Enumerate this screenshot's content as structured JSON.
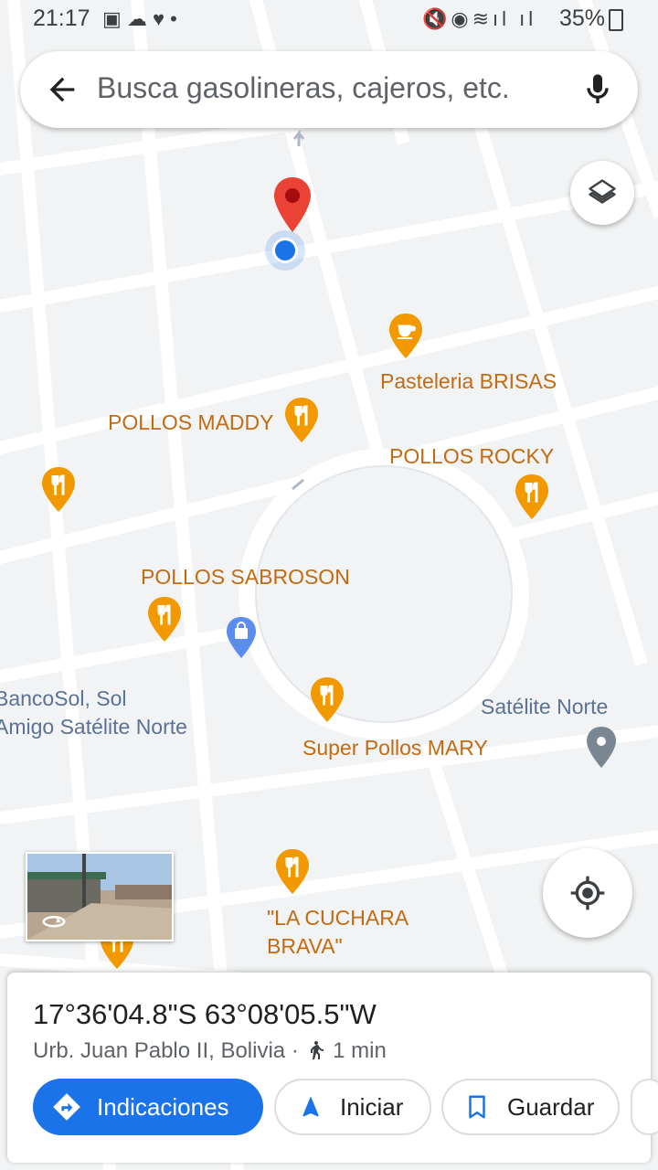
{
  "status_bar": {
    "time": "21:17",
    "battery": "35%"
  },
  "search": {
    "placeholder": "Busca gasolineras, cajeros, etc."
  },
  "map": {
    "pois": [
      {
        "name": "Pasteleria BRISAS",
        "type": "cafe-icon"
      },
      {
        "name": "POLLOS MADDY",
        "type": "restaurant-icon"
      },
      {
        "name": "POLLOS ROCKY",
        "type": "restaurant-icon"
      },
      {
        "name": "POLLOS SABROSON",
        "type": "restaurant-icon"
      },
      {
        "name": "Super Pollos MARY",
        "type": "restaurant-icon"
      },
      {
        "name": "\"LA CUCHARA",
        "name2": "BRAVA\"",
        "type": "restaurant-icon"
      }
    ],
    "places": [
      {
        "line1": "BancoSol, Sol",
        "line2": "Amigo Satélite Norte"
      },
      {
        "line1": "Satélite Norte"
      }
    ],
    "colors": {
      "road": "#ffffff",
      "block": "#f1f3f4",
      "poi": "#f29900",
      "pin": "#ea4335",
      "location": "#1a73e8"
    }
  },
  "sheet": {
    "coordinates": "17°36'04.8\"S 63°08'05.5\"W",
    "address": "Urb. Juan Pablo II, Bolivia",
    "travel_time": "1 min",
    "buttons": {
      "directions": "Indicaciones",
      "start": "Iniciar",
      "save": "Guardar"
    }
  }
}
